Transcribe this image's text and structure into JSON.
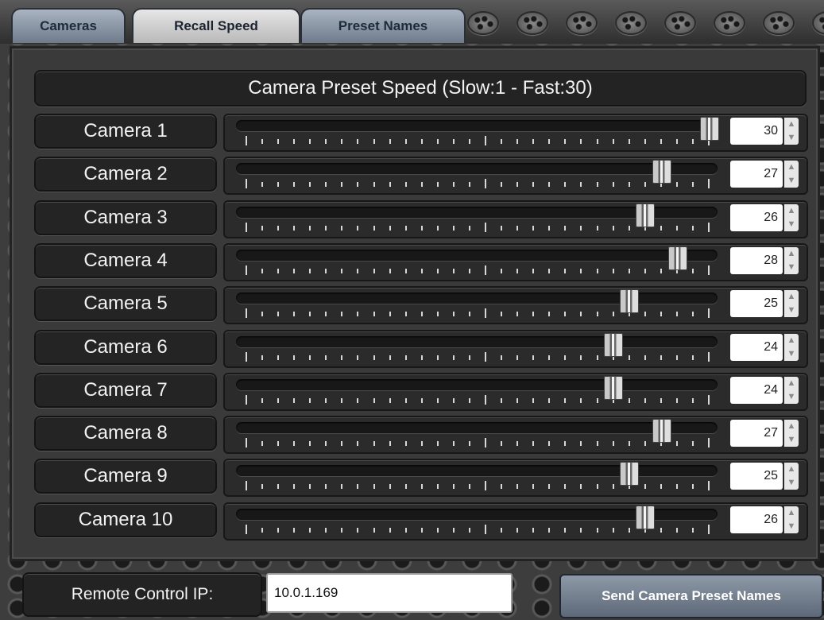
{
  "tabs": [
    {
      "label": "Cameras",
      "active": false
    },
    {
      "label": "Recall Speed",
      "active": true
    },
    {
      "label": "Preset Names",
      "active": false
    }
  ],
  "header": {
    "title": "Camera Preset Speed (Slow:1 - Fast:30)"
  },
  "slider": {
    "min": 1,
    "max": 30
  },
  "cameras": [
    {
      "label": "Camera 1",
      "value": "30"
    },
    {
      "label": "Camera 2",
      "value": "27"
    },
    {
      "label": "Camera 3",
      "value": "26"
    },
    {
      "label": "Camera 4",
      "value": "28"
    },
    {
      "label": "Camera 5",
      "value": "25"
    },
    {
      "label": "Camera 6",
      "value": "24"
    },
    {
      "label": "Camera 7",
      "value": "24"
    },
    {
      "label": "Camera 8",
      "value": "27"
    },
    {
      "label": "Camera 9",
      "value": "25"
    },
    {
      "label": "Camera 10",
      "value": "26"
    }
  ],
  "footer": {
    "ip_label": "Remote Control IP:",
    "ip_value": "10.0.1.169",
    "send_label": "Send Camera Preset Names"
  }
}
